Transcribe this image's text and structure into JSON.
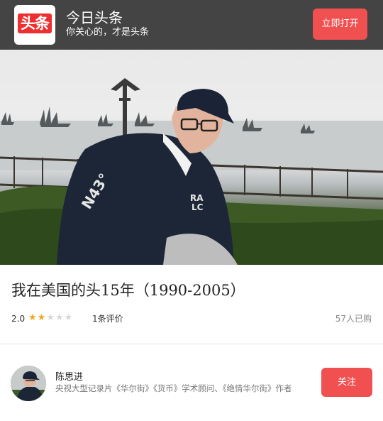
{
  "banner": {
    "logo_text": "头条",
    "app_name": "今日头条",
    "slogan": "你关心的，才是头条",
    "open_button": "立即打开"
  },
  "product": {
    "title": "我在美国的头15年（1990-2005）",
    "rating_score": "2.0",
    "rating_stars": {
      "filled": 2,
      "total": 5
    },
    "review_count": "1条评价",
    "buyer_count": "57人已购"
  },
  "author": {
    "name": "陈思进",
    "description": "央视大型记录片《华尔街》《货币》学术顾问、《绝情华尔街》作者",
    "follow_button": "关注"
  },
  "colors": {
    "banner_bg": "#444444",
    "accent": "#f15050",
    "star_filled": "#f5a623",
    "star_empty": "#d8d8d8"
  },
  "icons": [
    "toutiao-logo-icon",
    "star-icon",
    "avatar-photo"
  ]
}
